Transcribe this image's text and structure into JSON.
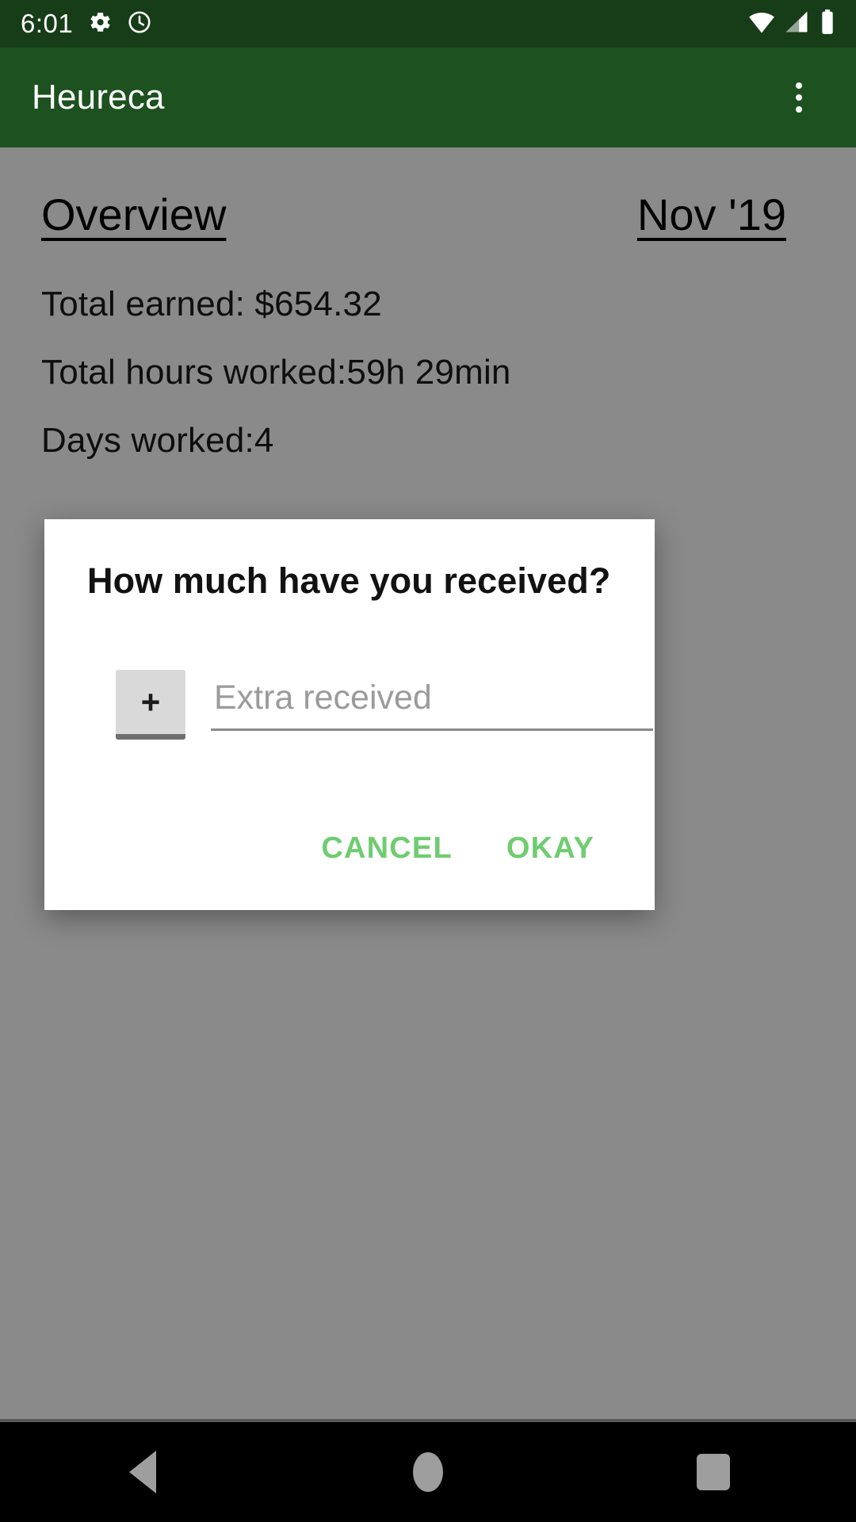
{
  "status_bar": {
    "time": "6:01",
    "icons": [
      "gear-icon",
      "clock-icon",
      "wifi-icon",
      "cellular-signal-icon",
      "battery-icon"
    ]
  },
  "app_bar": {
    "title": "Heureca",
    "overflow_label": "overflow-menu"
  },
  "content": {
    "overview_label": "Overview",
    "month_label": "Nov '19",
    "total_earned": "Total earned: $654.32",
    "total_hours": "Total hours worked:59h 29min",
    "days_worked": "Days worked:4"
  },
  "dialog": {
    "title": "How much have you received?",
    "plus_label": "+",
    "input_value": "",
    "input_placeholder": "Extra received",
    "cancel_label": "CANCEL",
    "okay_label": "OKAY"
  },
  "nav_bar": {
    "back_label": "Back",
    "home_label": "Home",
    "recents_label": "Recents"
  },
  "colors": {
    "status_bar": "#173d18",
    "app_bar": "#1d5220",
    "accent_green": "#6fcc70",
    "scrim": "rgba(0,0,0,0.46)",
    "plus_button_bg": "#d9d9d9"
  }
}
